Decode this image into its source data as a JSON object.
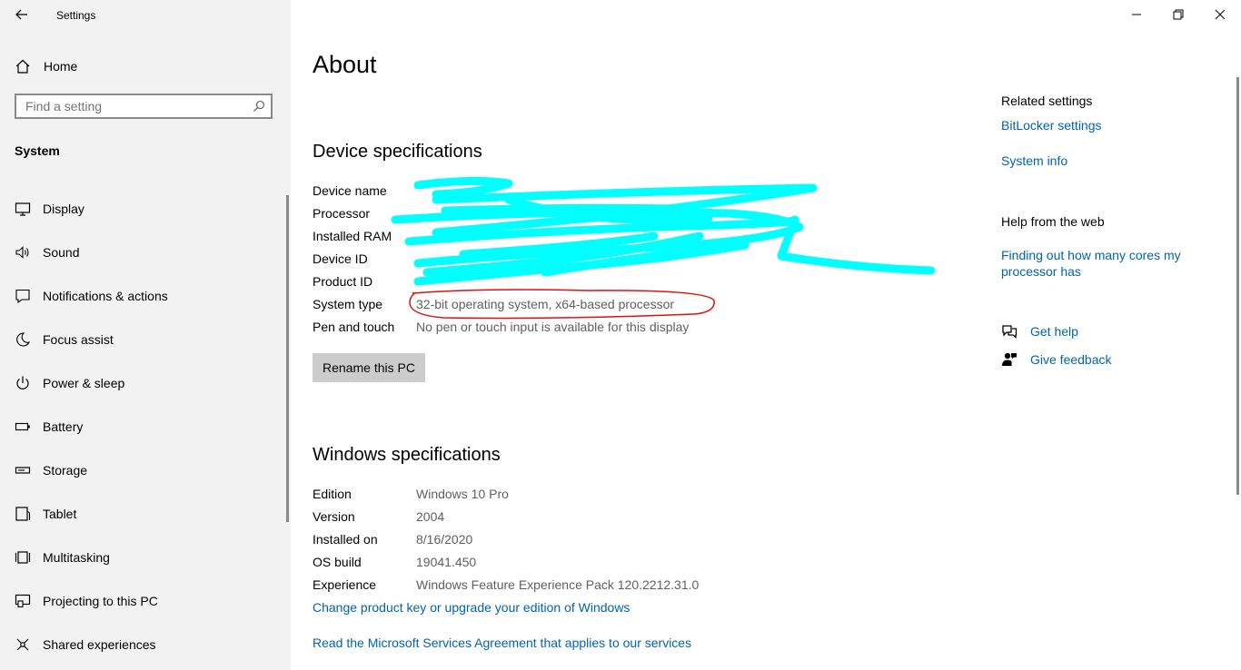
{
  "window": {
    "title": "Settings"
  },
  "sidebar": {
    "home_label": "Home",
    "search_placeholder": "Find a setting",
    "section_heading": "System",
    "items": [
      {
        "label": "Display",
        "icon": "display-icon"
      },
      {
        "label": "Sound",
        "icon": "sound-icon"
      },
      {
        "label": "Notifications & actions",
        "icon": "notifications-icon"
      },
      {
        "label": "Focus assist",
        "icon": "focus-assist-icon"
      },
      {
        "label": "Power & sleep",
        "icon": "power-icon"
      },
      {
        "label": "Battery",
        "icon": "battery-icon"
      },
      {
        "label": "Storage",
        "icon": "storage-icon"
      },
      {
        "label": "Tablet",
        "icon": "tablet-icon"
      },
      {
        "label": "Multitasking",
        "icon": "multitasking-icon"
      },
      {
        "label": "Projecting to this PC",
        "icon": "projecting-icon"
      },
      {
        "label": "Shared experiences",
        "icon": "shared-experiences-icon"
      }
    ]
  },
  "main": {
    "page_title": "About",
    "device_specs": {
      "heading": "Device specifications",
      "rows": [
        {
          "key": "Device name",
          "value": ""
        },
        {
          "key": "Processor",
          "value": ""
        },
        {
          "key": "Installed RAM",
          "value": ""
        },
        {
          "key": "Device ID",
          "value": ""
        },
        {
          "key": "Product ID",
          "value": ""
        },
        {
          "key": "System type",
          "value": "32-bit operating system, x64-based processor"
        },
        {
          "key": "Pen and touch",
          "value": "No pen or touch input is available for this display"
        }
      ],
      "rename_button": "Rename this PC"
    },
    "windows_specs": {
      "heading": "Windows specifications",
      "rows": [
        {
          "key": "Edition",
          "value": "Windows 10 Pro"
        },
        {
          "key": "Version",
          "value": "2004"
        },
        {
          "key": "Installed on",
          "value": "8/16/2020"
        },
        {
          "key": "OS build",
          "value": "19041.450"
        },
        {
          "key": "Experience",
          "value": "Windows Feature Experience Pack 120.2212.31.0"
        }
      ],
      "change_key_link": "Change product key or upgrade your edition of Windows",
      "msa_link": "Read the Microsoft Services Agreement that applies to our services"
    }
  },
  "related": {
    "heading": "Related settings",
    "bitlocker": "BitLocker settings",
    "system_info": "System info",
    "help_heading": "Help from the web",
    "cores_link": "Finding out how many cores my processor has",
    "get_help": "Get help",
    "give_feedback": "Give feedback"
  },
  "colors": {
    "sidebar_bg": "#f2f2f2",
    "link": "#0063b1",
    "scribble": "#00ffff",
    "annotation_circle": "#e01010",
    "button_bg": "#cccccc"
  }
}
